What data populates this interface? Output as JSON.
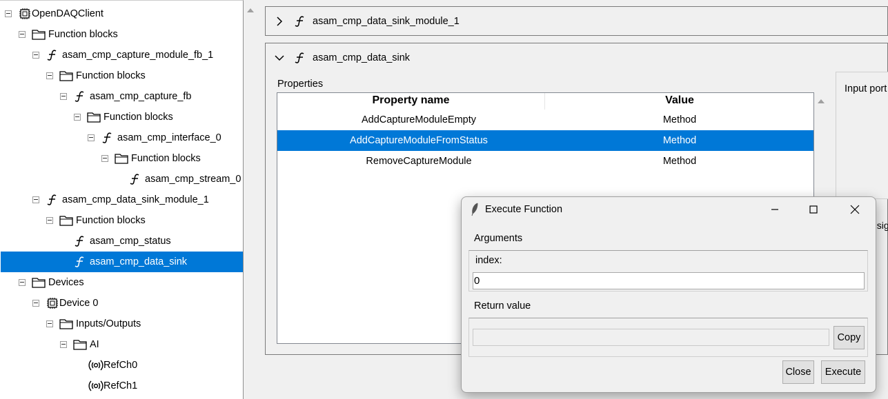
{
  "tree": {
    "items": [
      {
        "label": "OpenDAQClient",
        "icon": "chip-icon"
      },
      {
        "label": "Function blocks",
        "icon": "folder-icon"
      },
      {
        "label": "asam_cmp_capture_module_fb_1",
        "icon": "function-icon"
      },
      {
        "label": "Function blocks",
        "icon": "folder-icon"
      },
      {
        "label": "asam_cmp_capture_fb",
        "icon": "function-icon"
      },
      {
        "label": "Function blocks",
        "icon": "folder-icon"
      },
      {
        "label": "asam_cmp_interface_0",
        "icon": "function-icon"
      },
      {
        "label": "Function blocks",
        "icon": "folder-icon"
      },
      {
        "label": "asam_cmp_stream_0",
        "icon": "function-icon"
      },
      {
        "label": "asam_cmp_data_sink_module_1",
        "icon": "function-icon"
      },
      {
        "label": "Function blocks",
        "icon": "folder-icon"
      },
      {
        "label": "asam_cmp_status",
        "icon": "function-icon"
      },
      {
        "label": "asam_cmp_data_sink",
        "icon": "function-icon",
        "selected": true
      },
      {
        "label": "Devices",
        "icon": "folder-icon"
      },
      {
        "label": "Device 0",
        "icon": "chip-icon"
      },
      {
        "label": "Inputs/Outputs",
        "icon": "folder-icon"
      },
      {
        "label": "AI",
        "icon": "folder-icon"
      },
      {
        "label": "RefCh0",
        "icon": "signal-icon"
      },
      {
        "label": "RefCh1",
        "icon": "signal-icon"
      }
    ]
  },
  "panels": {
    "collapsed_title": "asam_cmp_data_sink_module_1",
    "expanded_title": "asam_cmp_data_sink",
    "properties_label": "Properties",
    "input_ports_label": "Input port",
    "signal_snippet": "t sig"
  },
  "properties_table": {
    "headers": [
      "Property name",
      "Value"
    ],
    "rows": [
      {
        "name": "AddCaptureModuleEmpty",
        "value": "Method"
      },
      {
        "name": "AddCaptureModuleFromStatus",
        "value": "Method",
        "selected": true
      },
      {
        "name": "RemoveCaptureModule",
        "value": "Method"
      }
    ]
  },
  "dialog": {
    "title": "Execute Function",
    "arguments_label": "Arguments",
    "index_label": "index:",
    "index_value": "0",
    "return_label": "Return value",
    "return_value": "",
    "copy_label": "Copy",
    "close_label": "Close",
    "execute_label": "Execute"
  },
  "colors": {
    "selection": "#0078d7",
    "background": "#f0f0f0"
  }
}
